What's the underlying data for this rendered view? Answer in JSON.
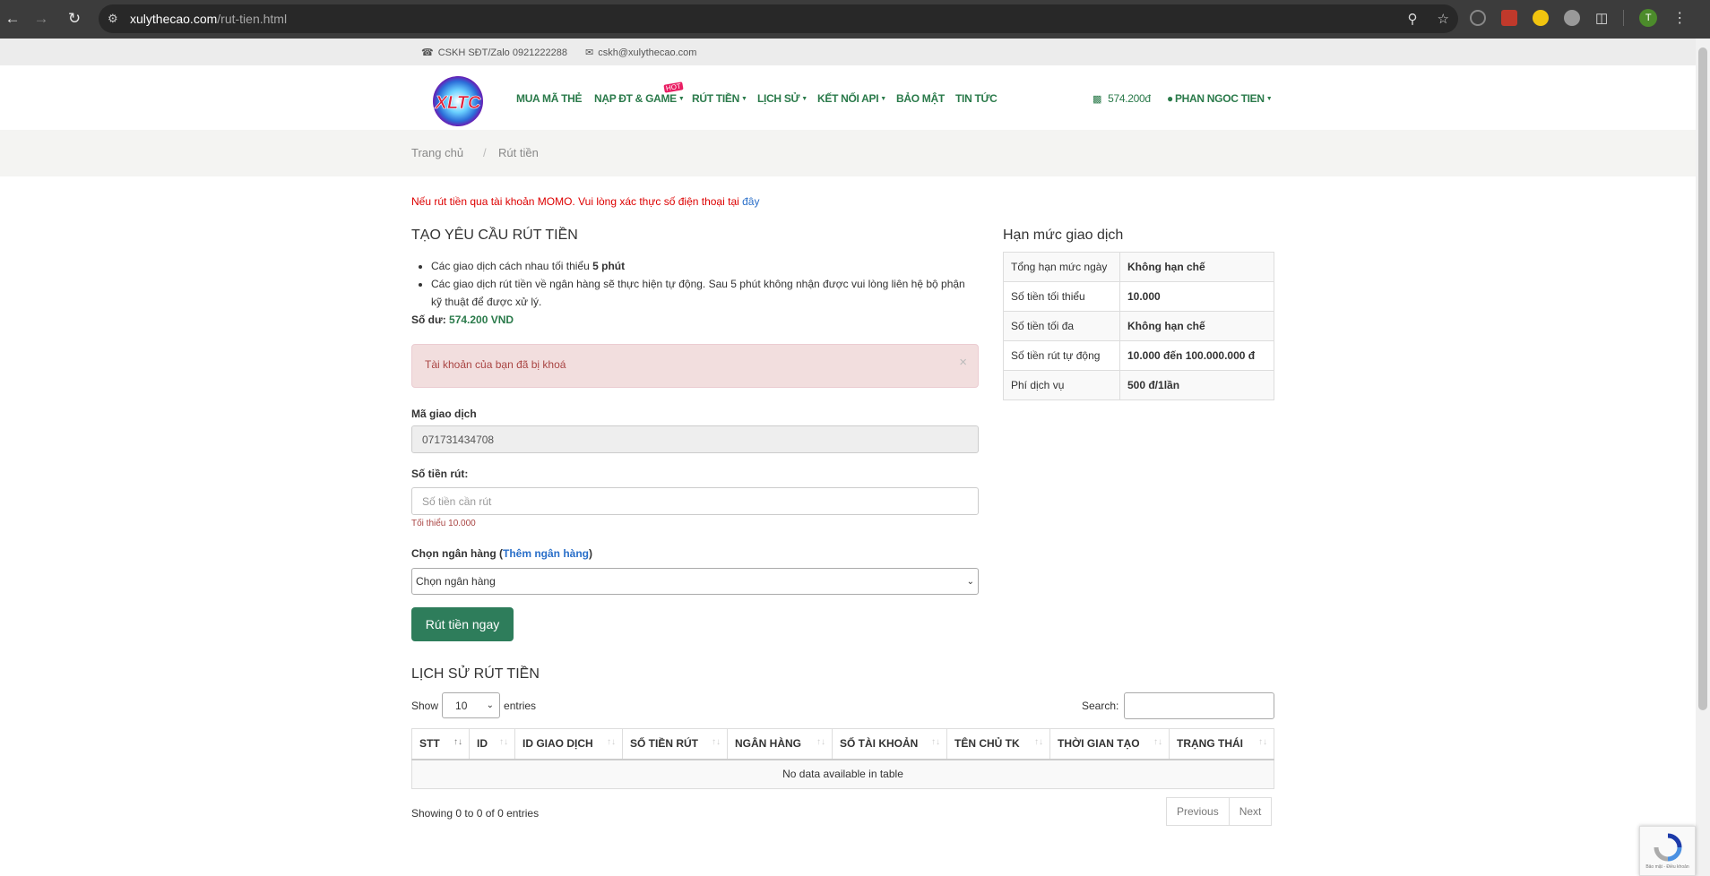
{
  "browser": {
    "url_domain": "xulythecao.com",
    "url_path": "/rut-tien.html",
    "profile_initial": "T"
  },
  "topbar": {
    "phone": "CSKH SĐT/Zalo 0921222288",
    "email": "cskh@xulythecao.com"
  },
  "navbar": {
    "logo_text": "XLTC",
    "menu": [
      {
        "label": "MUA MÃ THẺ"
      },
      {
        "label": "NẠP ĐT & GAME"
      },
      {
        "label": "RÚT TIỀN"
      },
      {
        "label": "LỊCH SỬ"
      },
      {
        "label": "KẾT NỐI API"
      },
      {
        "label": "BẢO MẬT"
      },
      {
        "label": "TIN TỨC"
      }
    ],
    "hot_badge": "HOT",
    "balance": "574.200đ",
    "user": "PHAN NGOC TIEN"
  },
  "breadcrumb": {
    "home": "Trang chủ",
    "current": "Rút tiền"
  },
  "notice": {
    "text": "Nếu rút tiền qua tài khoản MOMO. Vui lòng xác thực số điện thoại tại ",
    "link": "đây"
  },
  "form": {
    "title": "TẠO YÊU CẦU RÚT TIỀN",
    "rule1_prefix": "Các giao dịch cách nhau tối thiểu ",
    "rule1_bold": "5 phút",
    "rule2": "Các giao dịch rút tiền về ngân hàng sẽ thực hiện tự động. Sau 5 phút không nhận được vui lòng liên hệ bộ phận kỹ thuật để được xử lý.",
    "balance_label": "Số dư: ",
    "balance_value": "574.200 VND",
    "alert": "Tài khoản của bạn đã bị khoá",
    "txn_label": "Mã giao dịch",
    "txn_value": "071731434708",
    "amount_label": "Số tiền rút:",
    "amount_placeholder": "Số tiền cần rút",
    "amount_hint": "Tối thiểu 10.000",
    "bank_label": "Chọn ngân hàng (",
    "bank_link": "Thêm ngân hàng",
    "bank_label_end": ")",
    "bank_select": "Chọn ngân hàng",
    "submit": "Rút tiền ngay"
  },
  "limits": {
    "title": "Hạn mức giao dịch",
    "rows": [
      {
        "key": "Tổng hạn mức ngày",
        "value": "Không hạn chế"
      },
      {
        "key": "Số tiền tối thiểu",
        "value": "10.000"
      },
      {
        "key": "Số tiền tối đa",
        "value": "Không hạn chế"
      },
      {
        "key": "Số tiền rút tự động",
        "value": "10.000 đến 100.000.000 đ"
      },
      {
        "key": "Phí dịch vụ",
        "value": "500 đ/1lần"
      }
    ]
  },
  "history": {
    "title": "LỊCH SỬ RÚT TIỀN",
    "show_label": "Show",
    "entries_value": "10",
    "entries_label": "entries",
    "search_label": "Search:",
    "columns": [
      "STT",
      "ID",
      "ID GIAO DỊCH",
      "SỐ TIỀN RÚT",
      "NGÂN HÀNG",
      "SỐ TÀI KHOẢN",
      "TÊN CHỦ TK",
      "THỜI GIAN TẠO",
      "TRẠNG THÁI"
    ],
    "empty": "No data available in table",
    "info": "Showing 0 to 0 of 0 entries",
    "prev": "Previous",
    "next": "Next"
  },
  "recaptcha": {
    "text": "Bảo mật - Điều khoản"
  }
}
